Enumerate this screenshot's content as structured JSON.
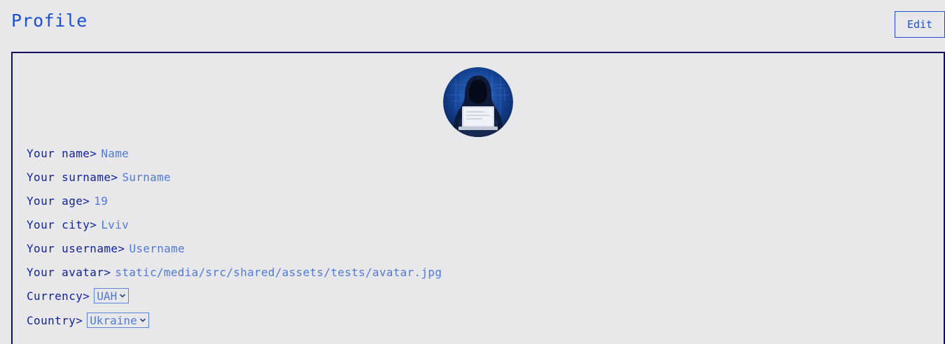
{
  "header": {
    "title": "Profile",
    "edit_label": "Edit"
  },
  "profile": {
    "avatar_icon": "hooded-hacker-avatar",
    "fields": [
      {
        "label": "Your name>",
        "value": "Name"
      },
      {
        "label": "Your surname>",
        "value": "Surname"
      },
      {
        "label": "Your age>",
        "value": "19"
      },
      {
        "label": "Your city>",
        "value": "Lviv"
      },
      {
        "label": "Your username>",
        "value": "Username"
      },
      {
        "label": "Your avatar>",
        "value": "static/media/src/shared/assets/tests/avatar.jpg"
      }
    ],
    "currency": {
      "label": "Currency>",
      "selected": "UAH"
    },
    "country": {
      "label": "Country>",
      "selected": "Ukraine"
    }
  },
  "colors": {
    "accent": "#1a4fd6",
    "label": "#13239a",
    "value": "#4f7ad8",
    "card_border": "#10105a",
    "background": "#e8e8ea"
  }
}
